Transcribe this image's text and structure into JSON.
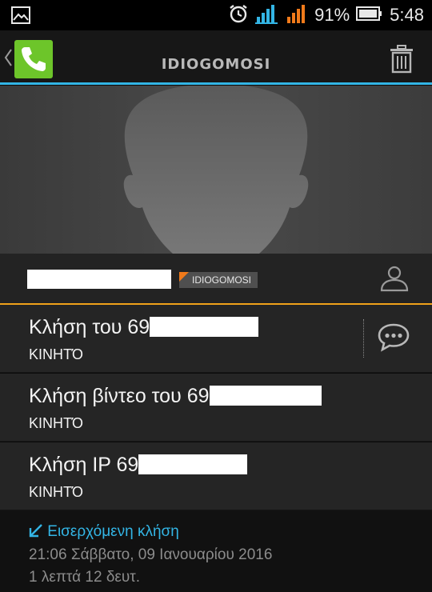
{
  "status_bar": {
    "battery_percent": "91%",
    "time": "5:48",
    "icons": [
      "image-notification-icon",
      "alarm-icon",
      "signal-sim1-icon",
      "signal-sim2-icon",
      "battery-icon"
    ],
    "colors": {
      "sim1": "#33b5e5",
      "sim2": "#f07a1a"
    }
  },
  "action_bar": {
    "title": "IDIOGOMOSI",
    "accent_color": "#33b5e5",
    "app_icon_color": "#6dc52a"
  },
  "contact": {
    "account_label": "IDIOGOMOSI",
    "tag_color": "#f07a1a",
    "divider_color": "#f0a21a"
  },
  "calls": [
    {
      "label": "Κλήση του 69",
      "type": "ΚΙΝΗΤΌ"
    },
    {
      "label": "Κλήση βίντεο του 69",
      "type": "ΚΙΝΗΤΌ"
    },
    {
      "label": "Κλήση IP 69",
      "type": "ΚΙΝΗΤΌ"
    }
  ],
  "history": {
    "call_type": "Εισερχόμενη κλήση",
    "datetime": "21:06 Σάββατο, 09 Ιανουαρίου 2016",
    "duration": "1 λεπτά 12 δευτ."
  }
}
